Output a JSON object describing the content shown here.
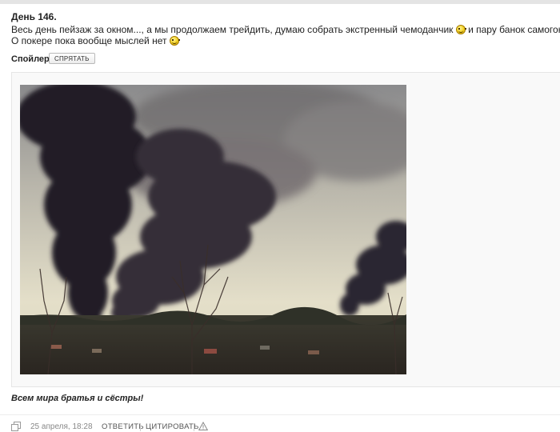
{
  "post": {
    "title": "День 146.",
    "line1_part1": "Весь день пейзаж за окном..., а мы продолжаем трейдить, думаю собрать экстренный чемоданчик",
    "line1_part2": "и пару банок самогона",
    "line2": "О покере пока вообще мыслей нет",
    "closing": "Всем мира братья и сёстры!"
  },
  "spoiler": {
    "label": "Спойлер:",
    "button_label": "СПРЯТАТЬ"
  },
  "footer": {
    "timestamp": "25 апреля, 18:28",
    "reply_label": "ОТВЕТИТЬ",
    "quote_label": "ЦИТИРОВАТЬ"
  },
  "icons": {
    "smiley": "smiley-icon",
    "copy": "copy-link-icon",
    "report": "warning-icon"
  },
  "colors": {
    "text": "#222222",
    "muted": "#888888",
    "smoke": "#2b2630",
    "sky": "#ddd8c4"
  }
}
